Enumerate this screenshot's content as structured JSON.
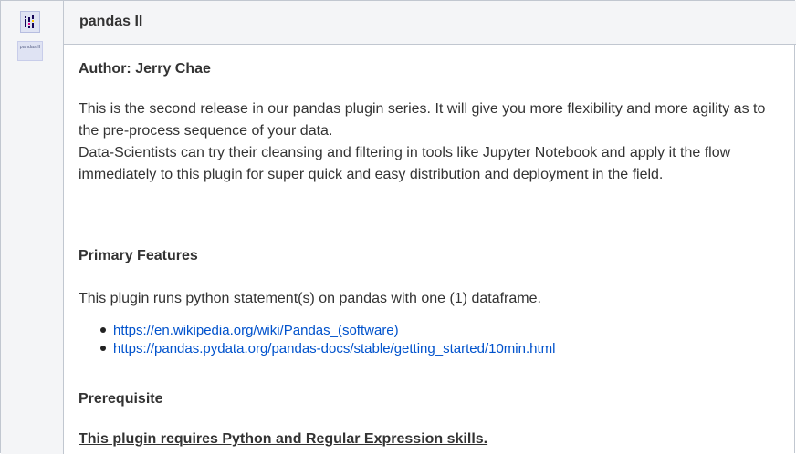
{
  "plugin": {
    "title": "pandas II",
    "icon_name": "pandas-plugin-icon",
    "icon_label": "pandas II"
  },
  "author": "Author: Jerry Chae",
  "description": [
    "This is the second release in our pandas plugin series.  It will give you more flexibility and more agility as to the pre-process sequence of your data.",
    "Data-Scientists can try their cleansing and filtering in tools like Jupyter Notebook and apply it the flow immediately to this plugin for super quick and easy distribution and deployment in the field."
  ],
  "primary_features": {
    "heading": "Primary Features",
    "text": "This plugin runs python statement(s) on pandas with one (1) dataframe.",
    "links": [
      "https://en.wikipedia.org/wiki/Pandas_(software)",
      "https://pandas.pydata.org/pandas-docs/stable/getting_started/10min.html"
    ]
  },
  "prerequisite": {
    "heading": "Prerequisite",
    "requirement": "This plugin requires Python and Regular Expression skills."
  },
  "colors": {
    "link": "#0052cc",
    "header_bg": "#f4f5f7",
    "border": "#c1c7d0"
  }
}
